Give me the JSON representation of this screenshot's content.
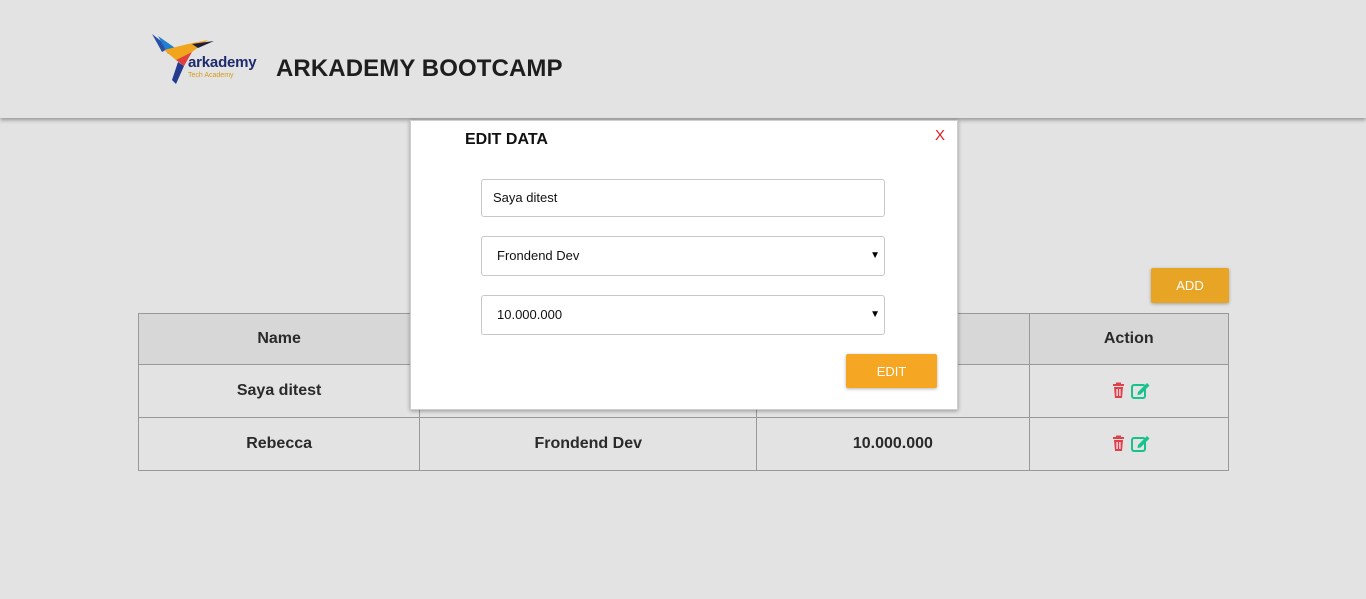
{
  "header": {
    "brand_title": "ARKADEMY BOOTCAMP",
    "logo_word": "arkademy",
    "logo_sub": "Tech Academy"
  },
  "toolbar": {
    "add_label": "ADD"
  },
  "table": {
    "columns": [
      "Name",
      "",
      "",
      "Action"
    ],
    "rows": [
      {
        "name": "Saya ditest",
        "job": "",
        "salary": ""
      },
      {
        "name": "Rebecca",
        "job": "Frondend Dev",
        "salary": "10.000.000"
      }
    ]
  },
  "modal": {
    "title": "EDIT DATA",
    "close_label": "X",
    "name_value": "Saya ditest",
    "job_value": "Frondend Dev",
    "salary_value": "10.000.000",
    "edit_label": "EDIT"
  },
  "colors": {
    "accent": "#f5a623",
    "add_button": "#e8a425",
    "delete_icon": "#e0404a",
    "edit_icon": "#17c28d",
    "close": "#e02020"
  },
  "icons": {
    "delete": "trash-icon",
    "edit": "edit-icon"
  }
}
